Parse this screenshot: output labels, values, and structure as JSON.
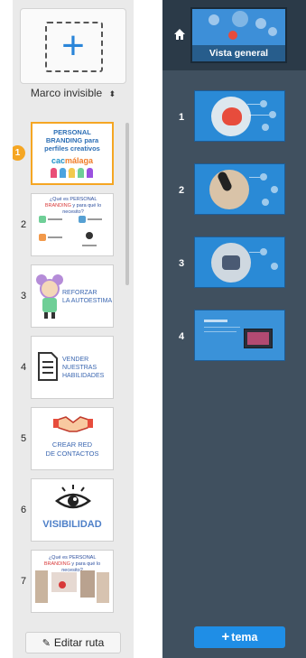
{
  "left_panel": {
    "add_frame_symbol": "+",
    "frame_type_select": {
      "value": "Marco invisible",
      "arrow": "⬍"
    },
    "slides": [
      {
        "number": "1",
        "title": "PERSONAL BRANDING para perfiles creativos",
        "logo_prefix": "cac",
        "logo_suffix": "málaga",
        "subtitle": "··· ··· ···",
        "badge": "1"
      },
      {
        "number": "2",
        "title_prefix": "¿Qué es PERSONAL",
        "title_highlight": "BRANDING",
        "title_suffix": "y para qué lo necesito?"
      },
      {
        "number": "3",
        "text_line1": "REFORZAR",
        "text_line2": "LA AUTOESTIMA"
      },
      {
        "number": "4",
        "text_line1": "VENDER",
        "text_line2": "NUESTRAS",
        "text_line3": "HABILIDADES"
      },
      {
        "number": "5",
        "text_line1": "CREAR RED",
        "text_line2": "DE CONTACTOS"
      },
      {
        "number": "6",
        "text": "VISIBILIDAD"
      },
      {
        "number": "7",
        "title_prefix": "¿Qué es PERSONAL",
        "title_highlight": "BRANDING",
        "title_suffix": "y para qué lo necesito?"
      }
    ],
    "edit_route_label": "Editar ruta"
  },
  "right_panel": {
    "overview_label": "Vista general",
    "topics": [
      {
        "number": "1"
      },
      {
        "number": "2"
      },
      {
        "number": "3"
      },
      {
        "number": "4"
      }
    ],
    "add_topic_label": "tema",
    "add_topic_symbol": "+"
  },
  "colors": {
    "accent_orange": "#f5a623",
    "accent_blue": "#1f8ee6",
    "dark_panel": "#40505f",
    "dark_header": "#2b3a48"
  }
}
